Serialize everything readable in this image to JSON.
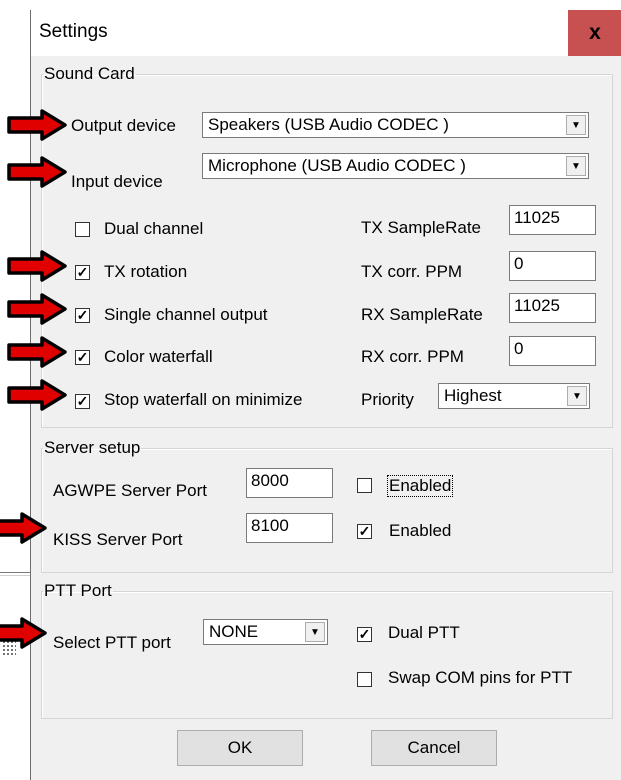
{
  "window": {
    "title": "Settings",
    "close_label": "x"
  },
  "sound_card": {
    "legend": "Sound Card",
    "output_device_label": "Output device",
    "output_device_value": "Speakers (USB Audio CODEC )",
    "input_device_label": "Input device",
    "input_device_value": "Microphone (USB Audio CODEC )",
    "dual_channel": {
      "label": "Dual channel",
      "checked": false
    },
    "tx_rotation": {
      "label": "TX rotation",
      "checked": true
    },
    "single_channel_output": {
      "label": "Single channel output",
      "checked": true
    },
    "color_waterfall": {
      "label": "Color waterfall",
      "checked": true
    },
    "stop_waterfall": {
      "label": "Stop waterfall on minimize",
      "checked": true
    },
    "tx_samplerate_label": "TX SampleRate",
    "tx_samplerate_value": "11025",
    "tx_corr_label": "TX corr. PPM",
    "tx_corr_value": "0",
    "rx_samplerate_label": "RX SampleRate",
    "rx_samplerate_value": "11025",
    "rx_corr_label": "RX corr. PPM",
    "rx_corr_value": "0",
    "priority_label": "Priority",
    "priority_value": "Highest"
  },
  "server_setup": {
    "legend": "Server setup",
    "agwpe_label": "AGWPE Server Port",
    "agwpe_port": "8000",
    "agwpe_enabled": {
      "label": "Enabled",
      "checked": false
    },
    "kiss_label": "KISS Server Port",
    "kiss_port": "8100",
    "kiss_enabled": {
      "label": "Enabled",
      "checked": true
    }
  },
  "ptt_port": {
    "legend": "PTT Port",
    "select_label": "Select PTT port",
    "select_value": "NONE",
    "dual_ptt": {
      "label": "Dual PTT",
      "checked": true
    },
    "swap_com": {
      "label": "Swap COM pins for PTT",
      "checked": false
    }
  },
  "buttons": {
    "ok": "OK",
    "cancel": "Cancel"
  },
  "check_glyph": "✓",
  "dropdown_glyph": "▼",
  "colors": {
    "close_button": "#c75050",
    "annotation_arrow": "#e00000",
    "dialog_bg": "#f0f0f0"
  },
  "annotations": {
    "icon": "red-arrow-icon",
    "count": 9
  }
}
